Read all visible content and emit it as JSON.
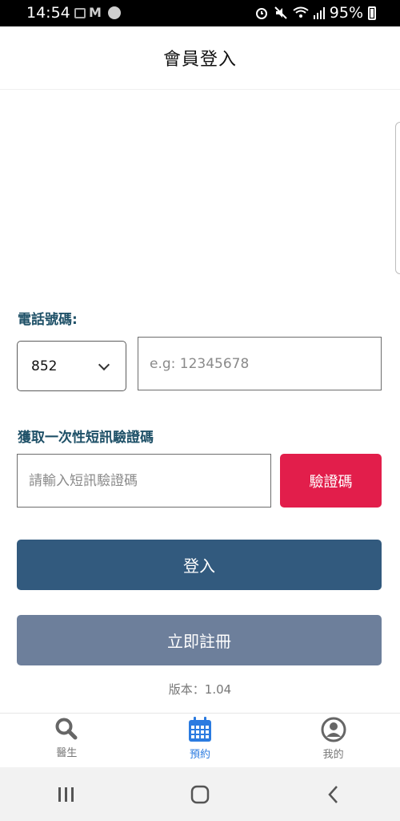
{
  "status_bar": {
    "time": "14:54",
    "battery": "95%"
  },
  "header": {
    "title": "會員登入"
  },
  "phone_section": {
    "label": "電話號碼:",
    "country_code": "852",
    "placeholder": "e.g: 12345678"
  },
  "otp_section": {
    "label": "獲取一次性短訊驗證碼",
    "placeholder": "請輸入短訊驗證碼",
    "verify_button": "驗證碼"
  },
  "actions": {
    "login": "登入",
    "register": "立即註冊"
  },
  "version": "版本：1.04",
  "tabs": [
    {
      "label": "醫生",
      "icon": "search-icon"
    },
    {
      "label": "預約",
      "icon": "calendar-icon"
    },
    {
      "label": "我的",
      "icon": "profile-icon"
    }
  ],
  "colors": {
    "accent_red": "#e21e4b",
    "login_blue": "#325a7e",
    "register_grey_blue": "#6d7f9b",
    "label_teal": "#1f5168",
    "active_tab": "#2b7be0"
  }
}
